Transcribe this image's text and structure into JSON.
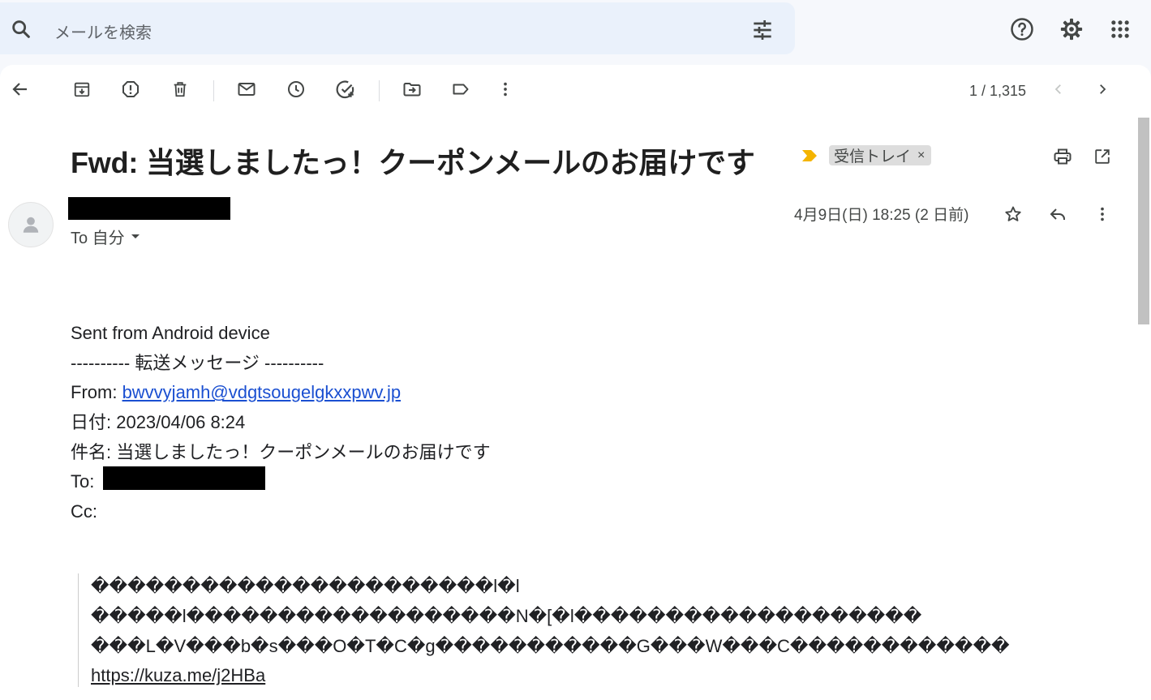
{
  "search": {
    "placeholder": "メールを検索"
  },
  "subject": {
    "title": "Fwd: 当選しましたっ！クーポンメールのお届けです",
    "label": "受信トレイ",
    "label_close": "×"
  },
  "pager": {
    "text": "1 / 1,315"
  },
  "message": {
    "to_label": "To 自分",
    "date": "4月9日(日) 18:25 (2 日前)"
  },
  "body": {
    "line1": "Sent from Android device",
    "line2": "---------- 転送メッセージ ----------",
    "from_label": "From: ",
    "from_email": "bwvvyjamh@vdgtsougelgkxxpwv.jp",
    "date_line": "日付: 2023/04/06 8:24",
    "subject_line": "件名: 当選しましたっ！クーポンメールのお届けです",
    "to_label": "To: ",
    "cc_label": "Cc:"
  },
  "quote": {
    "line1": "����������������������l�l",
    "line2": "�����l������������������N�[�l�������������������",
    "line3": "���L�V���b�s���O�T�C�g�����������G���W���C������������",
    "link": "https://kuza.me/j2HBa"
  },
  "colors": {
    "link": "#1a4fd1",
    "importance_marker": "#f4b400",
    "search_bg": "#eaf1fb",
    "page_bg": "#f6f8fc"
  }
}
